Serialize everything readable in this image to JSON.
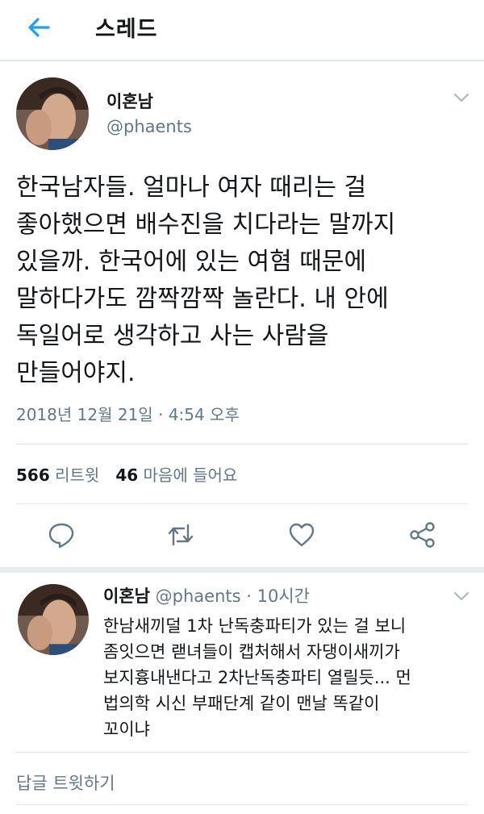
{
  "header": {
    "title": "스레드",
    "back_icon": "back-arrow-icon"
  },
  "tweet": {
    "author_name": "이혼남",
    "author_handle": "@phaents",
    "text_lines": [
      "한국남자들. 얼마나 여자 때리는 걸",
      "좋아했으면 배수진을 치다라는 말까지",
      "있을까. 한국어에 있는 여혐 때문에",
      "말하다가도 깜짝깜짝 놀란다. 내 안에",
      "독일어로 생각하고 사는 사람을",
      "만들어야지."
    ],
    "timestamp": "2018년 12월 21일 · 4:54 오후",
    "retweet_count": "566",
    "retweet_label": "리트윗",
    "like_count": "46",
    "like_label": "마음에 들어요"
  },
  "actions": [
    "reply-icon",
    "retweet-icon",
    "heart-icon",
    "share-icon"
  ],
  "reply": {
    "author_name": "이혼남",
    "meta": "@phaents · 10시간",
    "text_lines": [
      "한남새끼덜 1차 난독충파티가 있는 걸 보니",
      "좀잇으면 랟녀들이 캡처해서 자댕이새끼가",
      "보지흉내낸다고 2차난독충파티 열릴듯... 먼",
      "법의학 시신 부패단계 같이 맨날 똑같이",
      "꼬이냐"
    ]
  },
  "compose": {
    "placeholder": "답글 트윗하기"
  },
  "colors": {
    "accent": "#1da1f2",
    "secondary_text": "#657786",
    "divider": "#e1e8ed"
  }
}
